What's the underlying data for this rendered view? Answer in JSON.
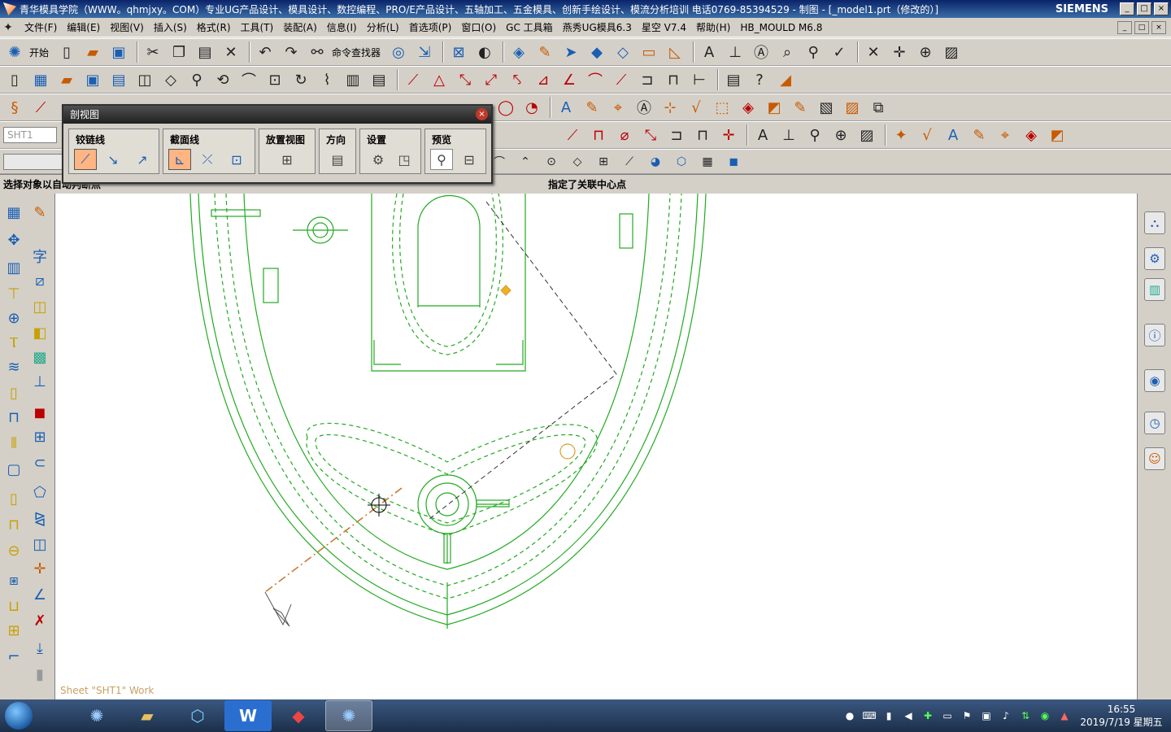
{
  "titlebar": {
    "title": "青华模具学院（WWW。qhmjxy。COM）专业UG产品设计、模具设计、数控编程、PRO/E产品设计、五轴加工、五金模具、创新手绘设计、模流分析培训  电话0769-85394529 - 制图 - [_model1.prt（修改的）]",
    "brand": "SIEMENS",
    "min": "_",
    "max": "□",
    "close": "×"
  },
  "menubar": {
    "items": [
      "文件(F)",
      "编辑(E)",
      "视图(V)",
      "插入(S)",
      "格式(R)",
      "工具(T)",
      "装配(A)",
      "信息(I)",
      "分析(L)",
      "首选项(P)",
      "窗口(O)",
      "GC 工具箱",
      "燕秀UG模具6.3",
      "星空 V7.4",
      "帮助(H)",
      "HB_MOULD M6.8"
    ],
    "doc_min": "_",
    "doc_max": "□",
    "doc_close": "×"
  },
  "toolbar": {
    "start_label": "开始",
    "cmd_finder": "命令查找器",
    "sheet_field": "SHT1"
  },
  "selection_bar": {
    "left_status": "选择对象以自动判断点",
    "center_status": "指定了关联中心点"
  },
  "dialog": {
    "title": "剖视图",
    "close": "×",
    "groups": [
      {
        "label": "铰链线"
      },
      {
        "label": "截面线"
      },
      {
        "label": "放置视图"
      },
      {
        "label": "方向"
      },
      {
        "label": "设置"
      },
      {
        "label": "预览"
      }
    ]
  },
  "canvas": {
    "sheet_label": "Sheet \"SHT1\" Work",
    "geometry_color": "#22aa22",
    "section_color": "#c87a30"
  },
  "taskbar": {
    "time": "16:55",
    "date": "2019/7/19 星期五"
  }
}
